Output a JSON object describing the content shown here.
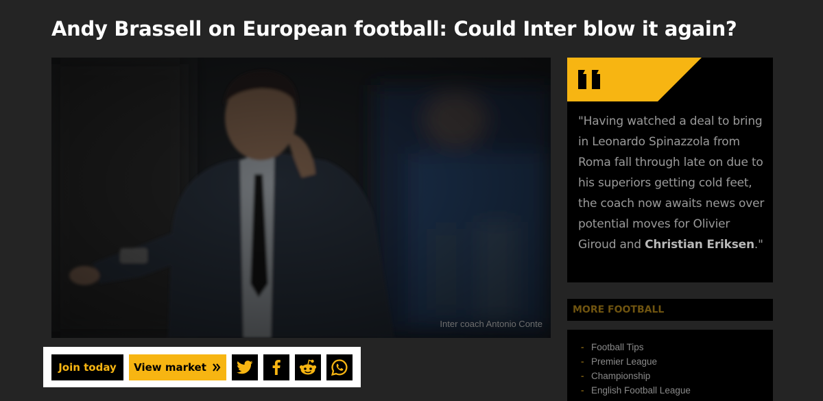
{
  "article": {
    "title": "Andy Brassell on European football: Could Inter blow it again?",
    "image_caption": "Inter coach Antonio Conte"
  },
  "actions": {
    "join_label": "Join today",
    "market_label": "View market",
    "market_icon": "double-chevron-right-icon",
    "share_icons": [
      "twitter-icon",
      "facebook-icon",
      "reddit-icon",
      "whatsapp-icon"
    ]
  },
  "quote": {
    "icon": "quote-icon",
    "text": "\"Having watched a deal to bring in Leonardo Spinazzola from Roma fall through late on due to his superiors getting cold feet, the coach now awaits news over potential moves for Olivier Giroud and ",
    "highlight": "Christian Eriksen",
    "suffix": ".\""
  },
  "more_football": {
    "heading": "MORE FOOTBALL",
    "items": [
      "Football Tips",
      "Premier League",
      "Championship",
      "English Football League"
    ]
  },
  "colors": {
    "accent": "#f7b512",
    "page_background": "#242424",
    "panel": "#000000"
  }
}
